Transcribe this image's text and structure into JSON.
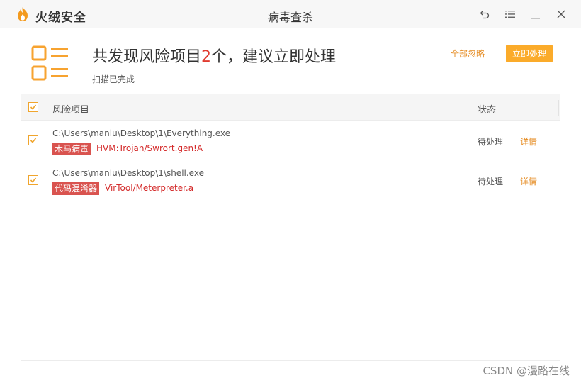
{
  "app": {
    "brand": "火绒安全",
    "window_title": "病毒查杀"
  },
  "colors": {
    "accent": "#fbab2a",
    "link": "#e58a1f",
    "danger": "#d42b2b",
    "tag_bg": "#d9534f"
  },
  "header": {
    "title_prefix": "共发现风险项目",
    "count": "2",
    "title_suffix": "个，建议立即处理",
    "subtitle": "扫描已完成",
    "ignore_all_label": "全部忽略",
    "handle_now_label": "立即处理"
  },
  "table": {
    "columns": [
      "风险项目",
      "状态"
    ],
    "rows": [
      {
        "checked": true,
        "path": "C:\\Users\\manlu\\Desktop\\1\\Everything.exe",
        "tag": "木马病毒",
        "virus_name": "HVM:Trojan/Swrort.gen!A",
        "status": "待处理",
        "detail_label": "详情"
      },
      {
        "checked": true,
        "path": "C:\\Users\\manlu\\Desktop\\1\\shell.exe",
        "tag": "代码混淆器",
        "virus_name": "VirTool/Meterpreter.a",
        "status": "待处理",
        "detail_label": "详情"
      }
    ]
  },
  "watermark": "CSDN @漫路在线"
}
